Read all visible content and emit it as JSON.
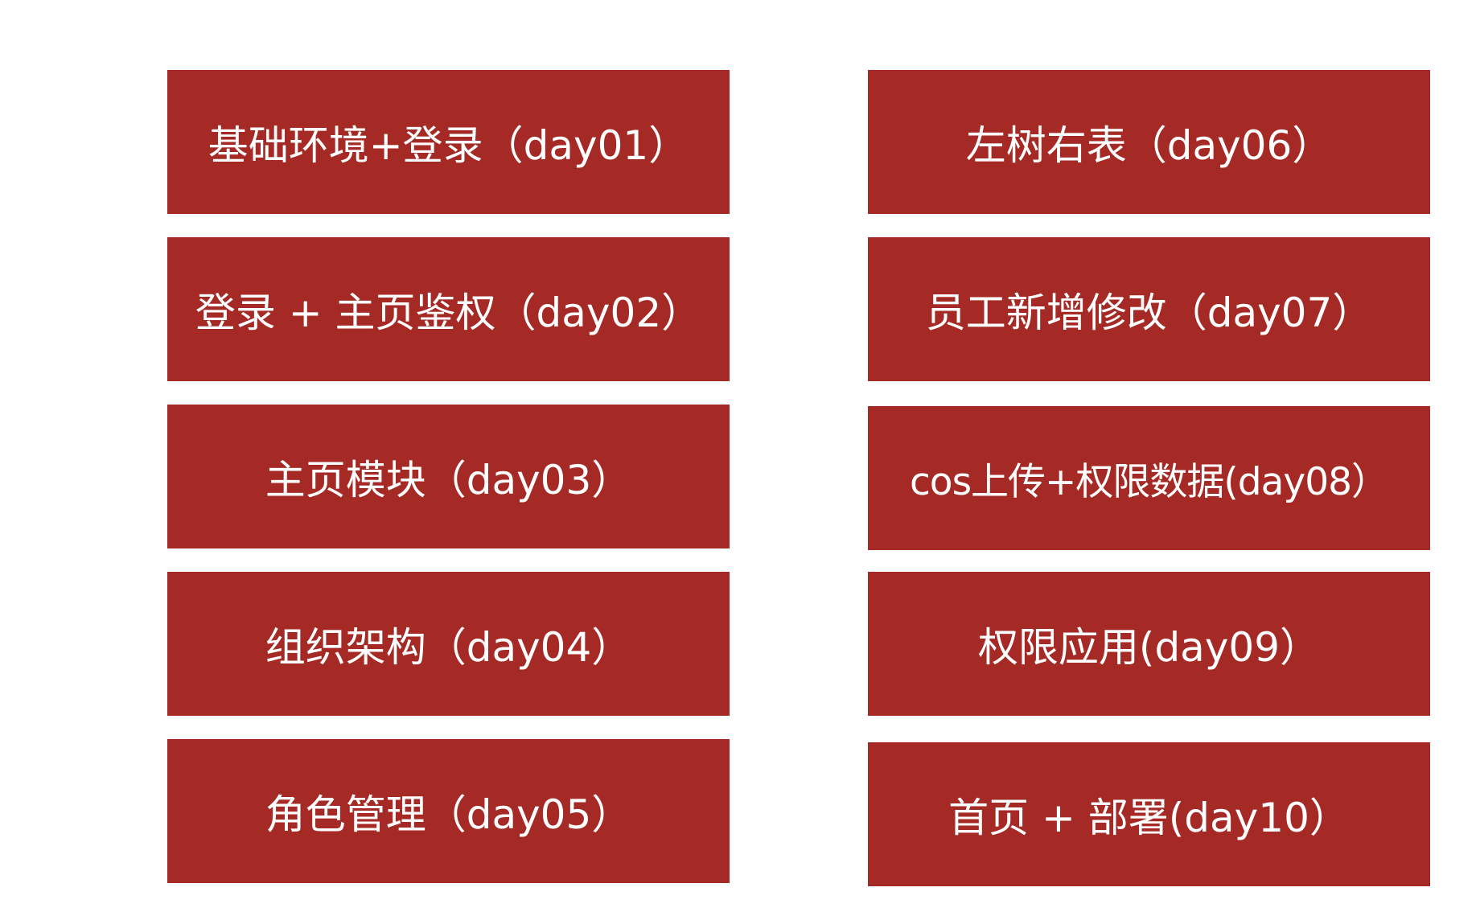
{
  "colors": {
    "box_fill": "#A52A25",
    "box_text": "#FFFFFF",
    "background": "#FFFFFF"
  },
  "modules": [
    {
      "label": "基础环境+登录（day01）"
    },
    {
      "label": "登录 + 主页鉴权（day02）"
    },
    {
      "label": "主页模块（day03）"
    },
    {
      "label": "组织架构（day04）"
    },
    {
      "label": "角色管理（day05）"
    },
    {
      "label": "左树右表（day06）"
    },
    {
      "label": "员工新增修改（day07）"
    },
    {
      "label": "cos上传+权限数据(day08）"
    },
    {
      "label": "权限应用(day09）"
    },
    {
      "label": "首页 + 部署(day10）"
    }
  ]
}
